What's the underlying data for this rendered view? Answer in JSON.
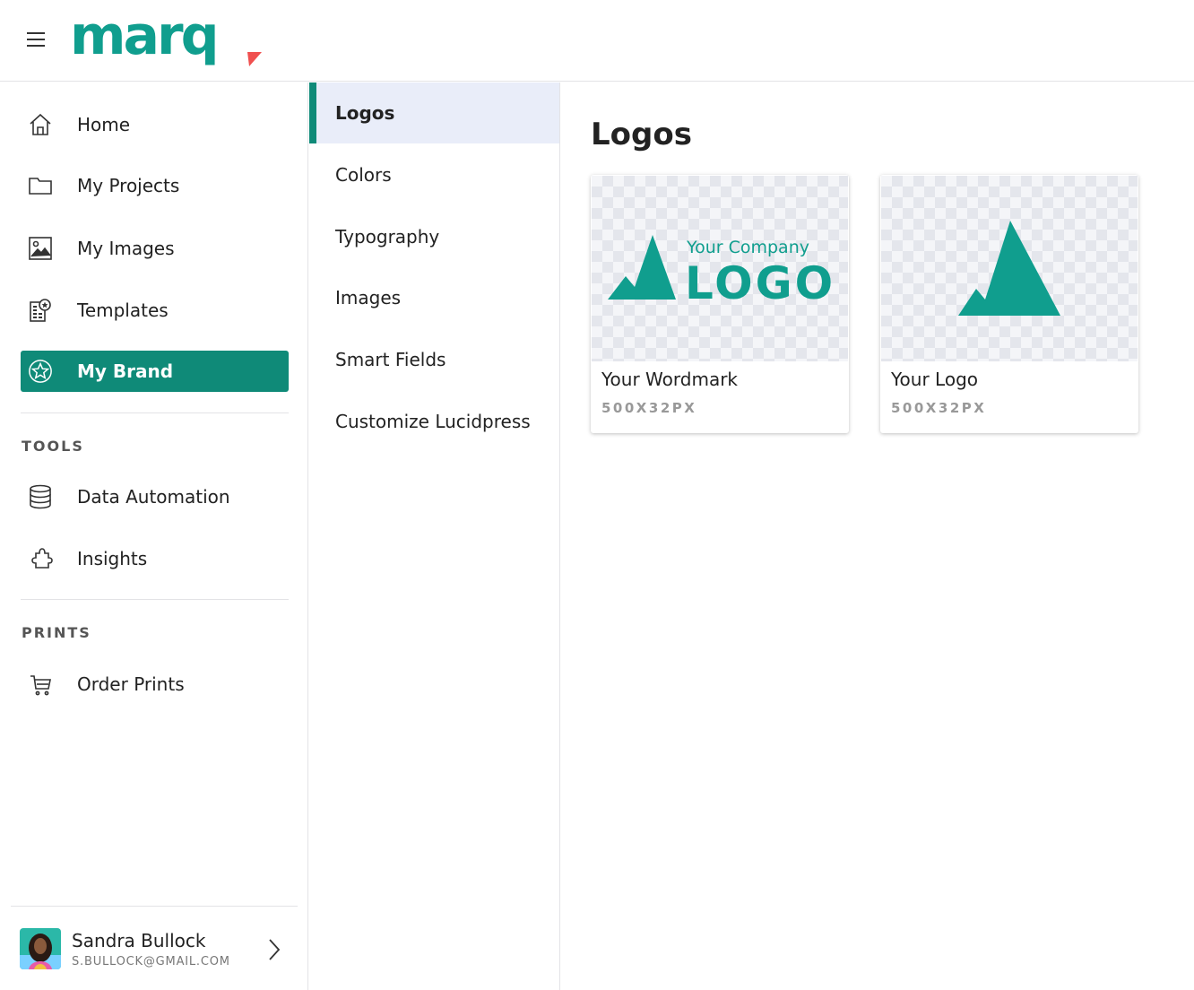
{
  "app": {
    "brand": "marq",
    "accent_color": "#0f8a78",
    "logo_teal": "#109e8e",
    "logo_red": "#f0504f"
  },
  "sidebar": {
    "items": [
      {
        "label": "Home",
        "icon": "home-icon"
      },
      {
        "label": "My Projects",
        "icon": "folder-icon"
      },
      {
        "label": "My Images",
        "icon": "image-icon"
      },
      {
        "label": "Templates",
        "icon": "templates-icon"
      },
      {
        "label": "My Brand",
        "icon": "brand-star-icon",
        "active": true
      }
    ],
    "tools_label": "TOOLS",
    "tools": [
      {
        "label": "Data Automation",
        "icon": "database-icon"
      },
      {
        "label": "Insights",
        "icon": "puzzle-icon"
      }
    ],
    "prints_label": "PRINTS",
    "prints": [
      {
        "label": "Order Prints",
        "icon": "cart-icon"
      }
    ]
  },
  "user": {
    "name": "Sandra Bullock",
    "email": "S.BULLOCK@GMAIL.COM"
  },
  "subnav": {
    "items": [
      {
        "label": "Logos",
        "active": true
      },
      {
        "label": "Colors"
      },
      {
        "label": "Typography"
      },
      {
        "label": "Images"
      },
      {
        "label": "Smart Fields"
      },
      {
        "label": "Customize Lucidpress"
      }
    ]
  },
  "main": {
    "title": "Logos",
    "cards": [
      {
        "title": "Your Wordmark",
        "size": "500X32PX",
        "preview_company": "Your Company",
        "preview_logo": "LOGO"
      },
      {
        "title": "Your Logo",
        "size": "500X32PX"
      }
    ]
  }
}
